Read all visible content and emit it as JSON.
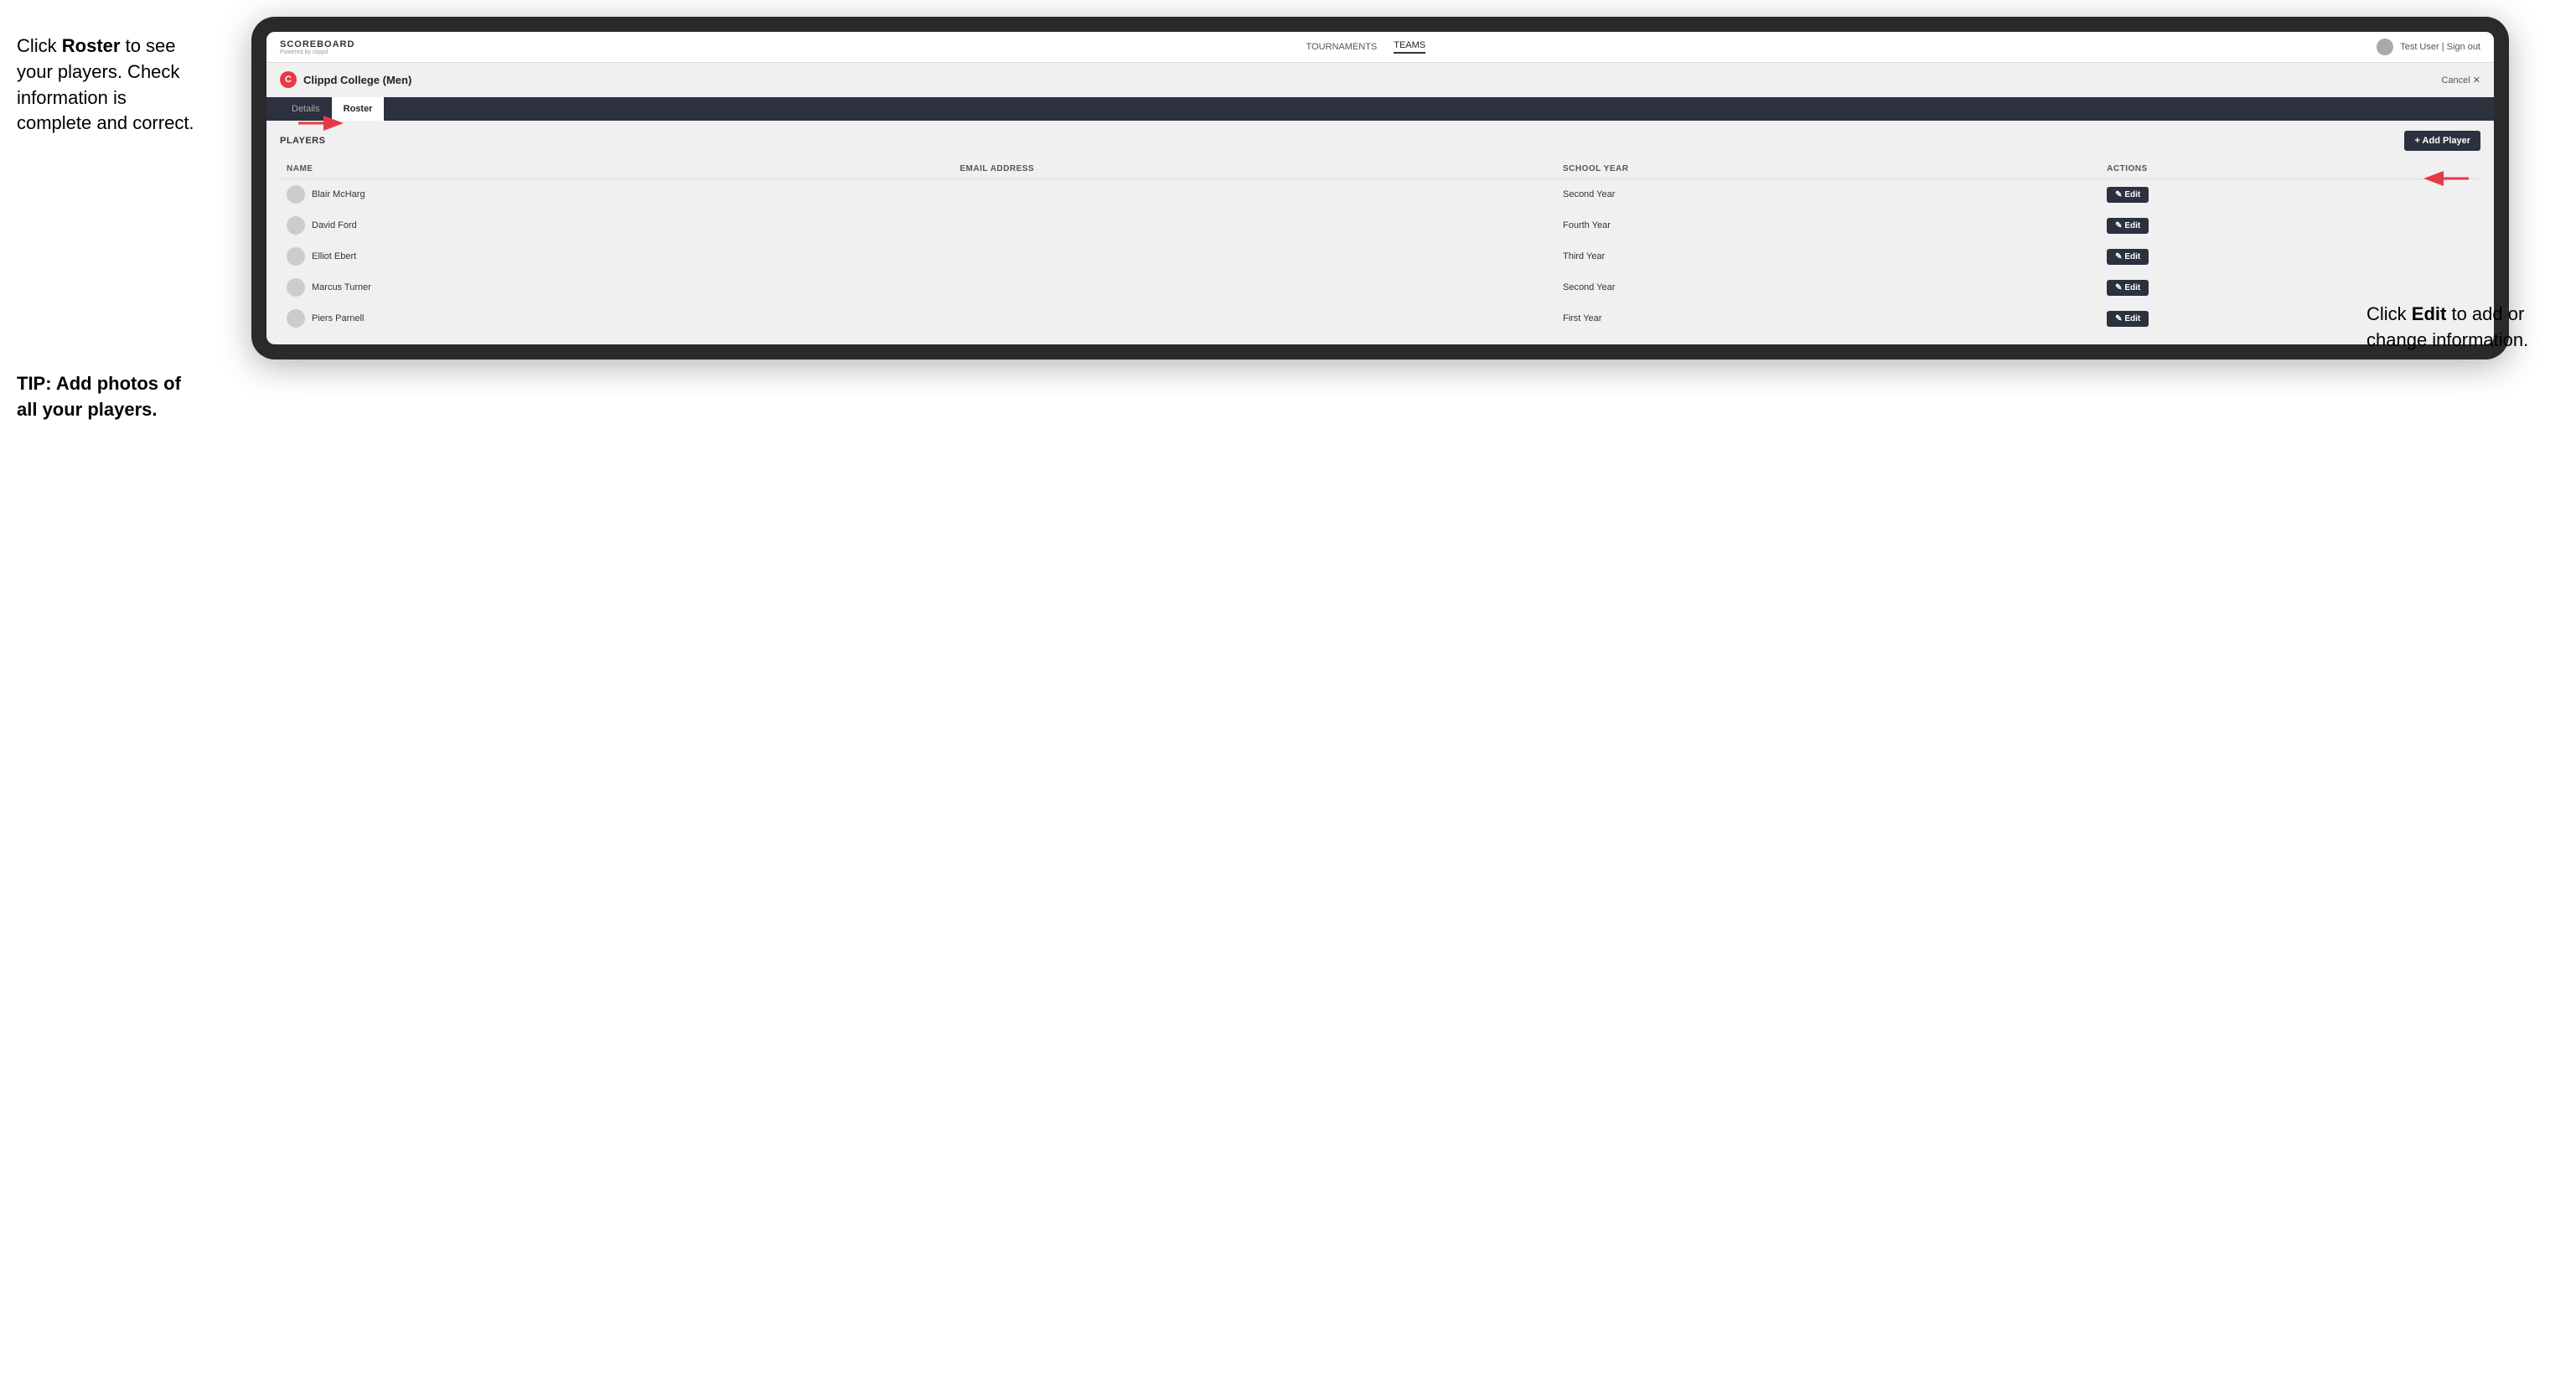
{
  "instructions": {
    "left_line1": "Click ",
    "left_bold1": "Roster",
    "left_line2": " to see your players. Check information is complete and correct.",
    "tip_prefix": "TIP: ",
    "tip_text": "Add photos of all your players."
  },
  "right_instructions": {
    "prefix": "Click ",
    "bold": "Edit",
    "suffix": " to add or change information."
  },
  "app": {
    "logo": "SCOREBOARD",
    "logo_sub": "Powered by clippd",
    "nav": [
      "TOURNAMENTS",
      "TEAMS"
    ],
    "active_nav": "TEAMS",
    "user": "Test User | Sign out"
  },
  "team": {
    "icon_letter": "C",
    "name": "Clippd College (Men)",
    "cancel_label": "Cancel ✕"
  },
  "tabs": [
    {
      "label": "Details",
      "active": false
    },
    {
      "label": "Roster",
      "active": true
    }
  ],
  "players_section": {
    "label": "PLAYERS",
    "add_button": "+ Add Player"
  },
  "table": {
    "columns": [
      "NAME",
      "EMAIL ADDRESS",
      "SCHOOL YEAR",
      "ACTIONS"
    ],
    "rows": [
      {
        "name": "Blair McHarg",
        "email": "",
        "school_year": "Second Year"
      },
      {
        "name": "David Ford",
        "email": "",
        "school_year": "Fourth Year"
      },
      {
        "name": "Elliot Ebert",
        "email": "",
        "school_year": "Third Year"
      },
      {
        "name": "Marcus Turner",
        "email": "",
        "school_year": "Second Year"
      },
      {
        "name": "Piers Parnell",
        "email": "",
        "school_year": "First Year"
      }
    ],
    "edit_label": "✎ Edit"
  }
}
